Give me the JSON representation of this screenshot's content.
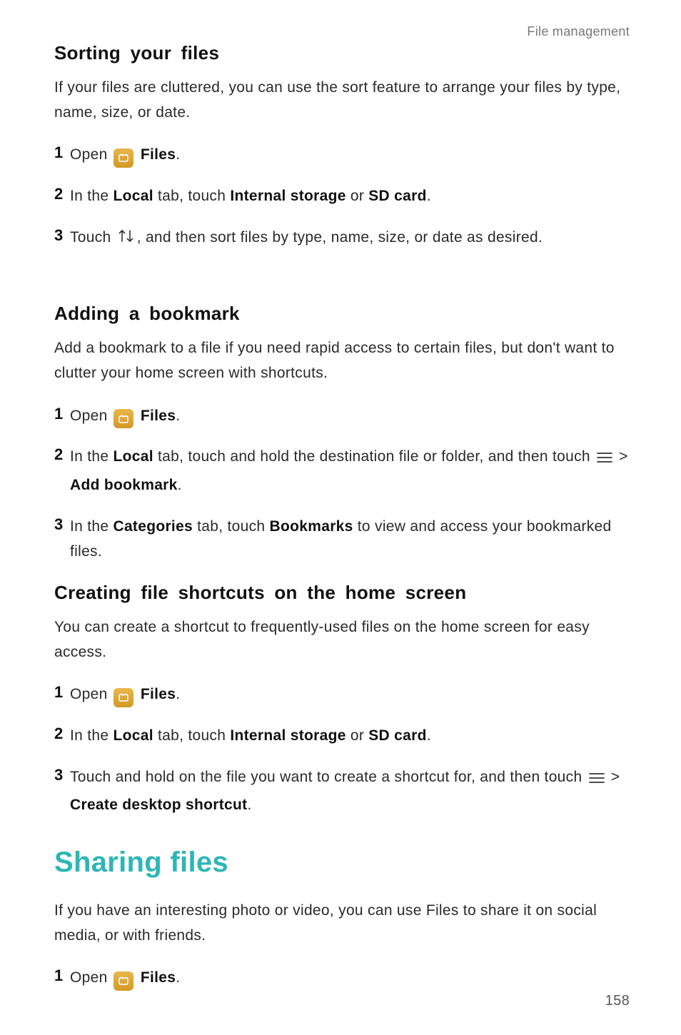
{
  "breadcrumb": "File management",
  "section_sort": {
    "heading": "Sorting your files",
    "intro": "If your files are cluttered, you can use the sort feature to arrange your files by type, name, size, or date.",
    "steps": {
      "s1": {
        "num": "1",
        "open": "Open ",
        "files": "Files",
        "dot": "."
      },
      "s2": {
        "num": "2",
        "t1": "In the ",
        "local": "Local",
        "t2": " tab, touch ",
        "internal": "Internal storage",
        "or": " or ",
        "sd": "SD card",
        "dot": "."
      },
      "s3": {
        "num": "3",
        "t1": "Touch ",
        "t2": ", and then sort files by type, name, size, or date as desired."
      }
    }
  },
  "section_bookmark": {
    "heading": "Adding a bookmark",
    "intro": "Add a bookmark to a file if you need rapid access to certain files, but don't want to clutter your home screen with shortcuts.",
    "steps": {
      "s1": {
        "num": "1",
        "open": "Open ",
        "files": "Files",
        "dot": "."
      },
      "s2": {
        "num": "2",
        "t1": "In the ",
        "local": "Local",
        "t2": " tab, touch and hold the destination file or folder, and then touch ",
        "gt": " > ",
        "add": "Add bookmark",
        "dot": "."
      },
      "s3": {
        "num": "3",
        "t1": "In the ",
        "cat": "Categories",
        "t2": " tab, touch ",
        "bkm": "Bookmarks",
        "t3": " to view and access your bookmarked files."
      }
    }
  },
  "section_shortcut": {
    "heading": "Creating file shortcuts on the home screen",
    "intro": "You can create a shortcut to frequently-used files on the home screen for easy access.",
    "steps": {
      "s1": {
        "num": "1",
        "open": "Open ",
        "files": "Files",
        "dot": "."
      },
      "s2": {
        "num": "2",
        "t1": "In the ",
        "local": "Local",
        "t2": " tab, touch ",
        "internal": "Internal storage",
        "or": " or ",
        "sd": "SD card",
        "dot": "."
      },
      "s3": {
        "num": "3",
        "t1": "Touch and hold on the file you want to create a shortcut for, and then touch ",
        "gt": " > ",
        "cds": "Create desktop shortcut",
        "dot": "."
      }
    }
  },
  "section_sharing": {
    "heading": "Sharing files",
    "intro_a": "If you have an interesting photo or video, you can use ",
    "intro_files": "Files",
    "intro_b": " to share it on social media, or with friends.",
    "steps": {
      "s1": {
        "num": "1",
        "open": "Open ",
        "files": "Files",
        "dot": "."
      }
    }
  },
  "page_number": "158"
}
